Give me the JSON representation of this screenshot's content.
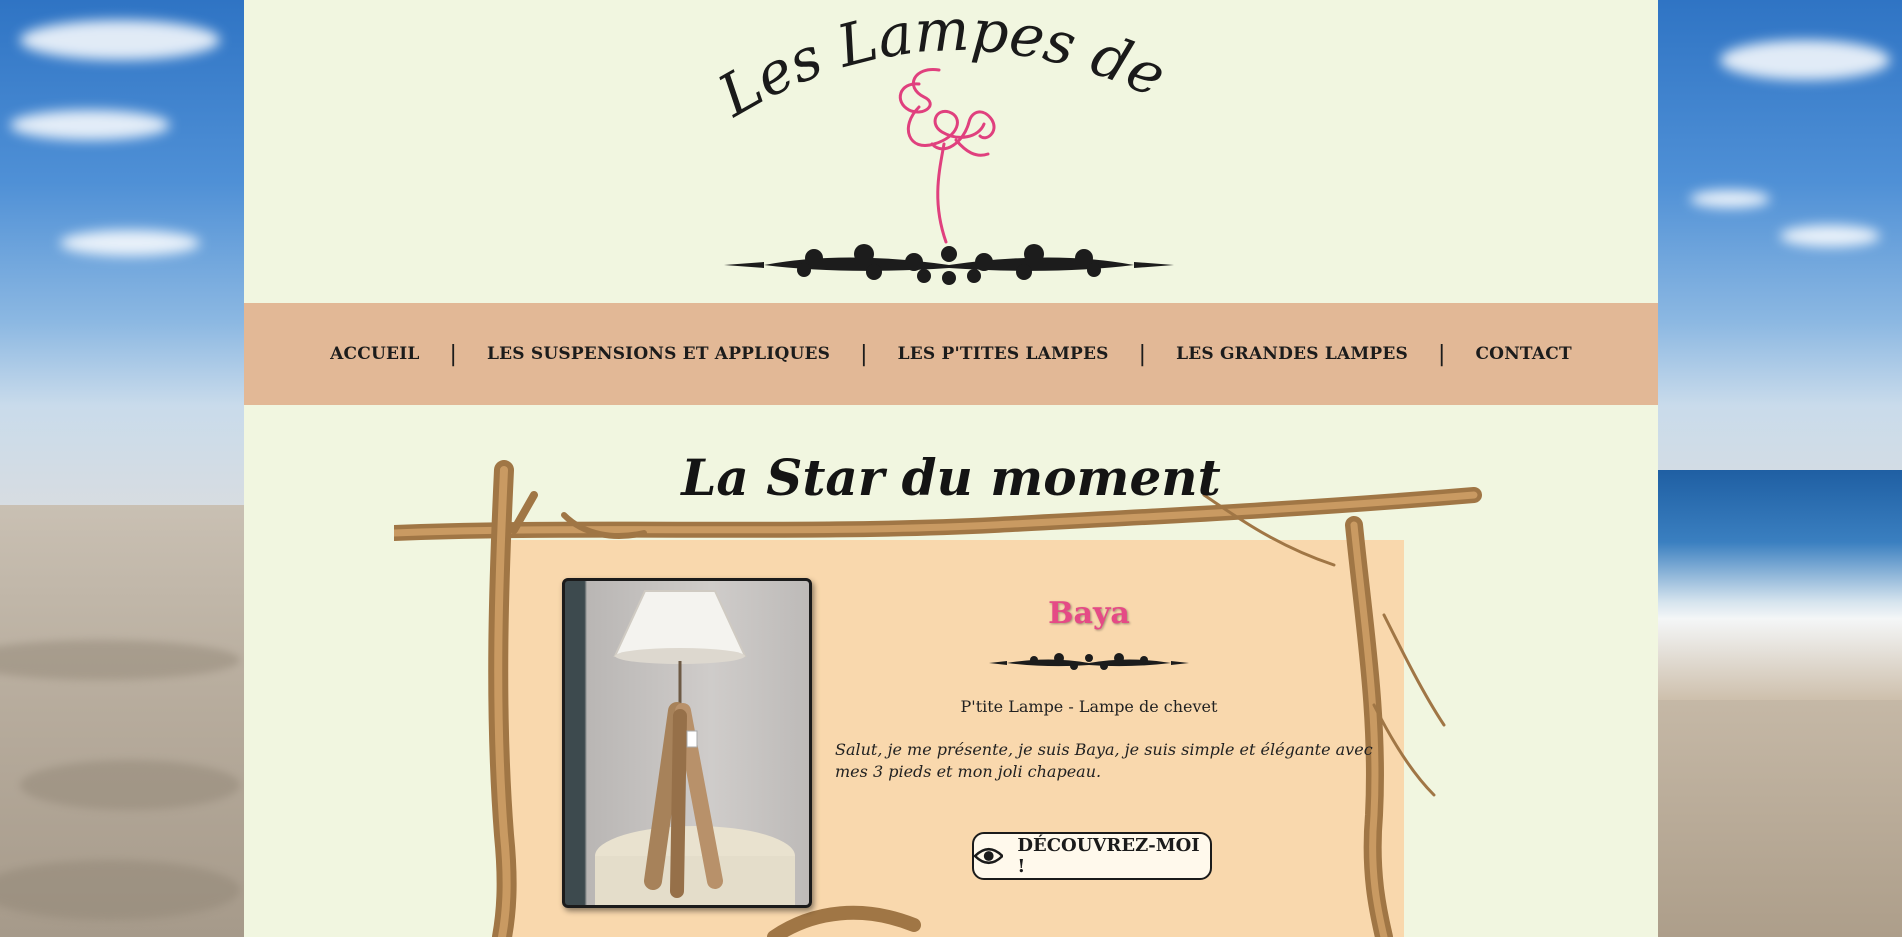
{
  "logo": {
    "title": "Les Lampes de Sylvie"
  },
  "nav": {
    "items": [
      {
        "label": "ACCUEIL"
      },
      {
        "label": "LES SUSPENSIONS ET APPLIQUES"
      },
      {
        "label": "LES P'TITES LAMPES"
      },
      {
        "label": "LES GRANDES LAMPES"
      },
      {
        "label": "CONTACT"
      }
    ],
    "separator": "|"
  },
  "featured": {
    "heading": "La Star du moment",
    "product_name": "Baya",
    "category": "P'tite Lampe - Lampe de chevet",
    "description": "Salut, je me présente, je suis Baya, je suis simple et élégante avec mes 3 pieds et mon joli chapeau.",
    "cta_label": "DÉCOUVREZ-MOI !",
    "cta_icon": "eye-icon"
  },
  "colors": {
    "panel_bg": "#f1f6e0",
    "nav_bg": "#e2b896",
    "card_bg": "#f9d8ad",
    "accent_pink": "#e54a86"
  }
}
